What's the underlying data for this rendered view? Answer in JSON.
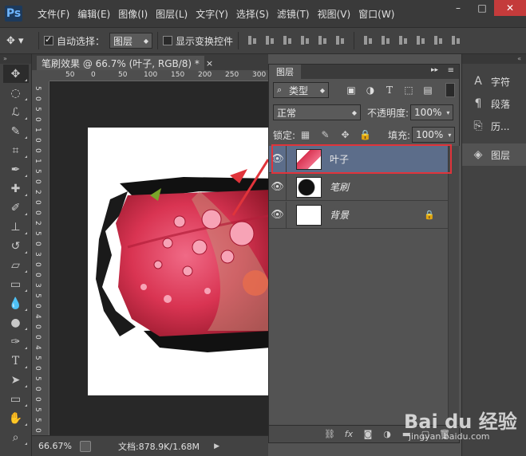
{
  "app": {
    "logo": "Ps"
  },
  "menu": [
    "文件(F)",
    "编辑(E)",
    "图像(I)",
    "图层(L)",
    "文字(Y)",
    "选择(S)",
    "滤镜(T)",
    "视图(V)",
    "窗口(W)"
  ],
  "window_controls": {
    "minimize": "–",
    "restore": "□",
    "close": "✕"
  },
  "options": {
    "auto_select_label": "自动选择：",
    "auto_select_checked": true,
    "auto_select_target": "图层",
    "show_transform_label": "显示变换控件"
  },
  "document": {
    "tab_title": "笔刷效果 @ 66.7% (叶子, RGB/8) *",
    "close": "×",
    "ruler_top": [
      "50",
      "0",
      "50",
      "100",
      "150",
      "200",
      "250",
      "300"
    ],
    "ruler_left": [
      "5",
      "0",
      "5",
      "0",
      "1",
      "0",
      "0",
      "1",
      "5",
      "0",
      "2",
      "0",
      "0",
      "2",
      "5",
      "0",
      "3",
      "0",
      "0",
      "3",
      "5",
      "0",
      "4",
      "0",
      "0",
      "4",
      "5",
      "0",
      "5",
      "0",
      "0",
      "5",
      "5",
      "0"
    ]
  },
  "status": {
    "zoom": "66.67%",
    "doc_size": "文档:878.9K/1.68M",
    "arrow": "▶"
  },
  "layers_panel": {
    "tab": "图层",
    "collapse": "▸▸",
    "menu": "≡",
    "filter_label": "类型",
    "blend_mode": "正常",
    "opacity_label": "不透明度:",
    "opacity_value": "100%",
    "lock_label": "锁定:",
    "fill_label": "填充:",
    "fill_value": "100%",
    "layers": [
      {
        "name": "叶子",
        "selected": true,
        "clipped": true
      },
      {
        "name": "笔刷",
        "selected": false
      },
      {
        "name": "背景",
        "selected": false,
        "locked": true
      }
    ],
    "footer_icons": [
      "link-icon",
      "fx-icon",
      "mask-icon",
      "adjustment-icon",
      "folder-icon",
      "new-layer-icon",
      "trash-icon"
    ],
    "footer_fx": "fx"
  },
  "dock": {
    "items": [
      {
        "label": "字符",
        "icon": "A"
      },
      {
        "label": "段落",
        "icon": "¶"
      },
      {
        "label": "历...",
        "icon": "⎘"
      }
    ],
    "layers_label": "图层"
  },
  "watermark": {
    "brand": "Bai du 经验",
    "url": "jingyan.baidu.com"
  }
}
